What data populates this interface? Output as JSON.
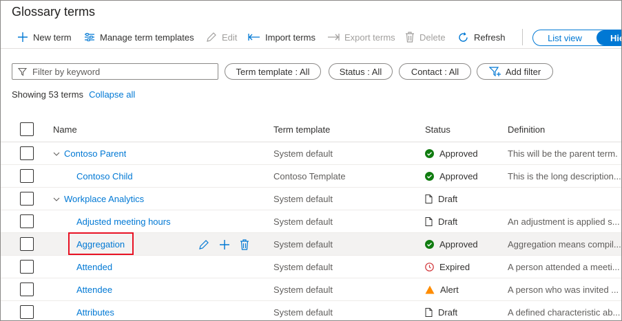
{
  "title": "Glossary terms",
  "toolbar": {
    "new_term": "New term",
    "manage_templates": "Manage term templates",
    "edit": "Edit",
    "import_terms": "Import terms",
    "export_terms": "Export terms",
    "delete": "Delete",
    "refresh": "Refresh"
  },
  "view_toggle": {
    "list": "List view",
    "hierarchy": "Hie"
  },
  "filters": {
    "keyword_placeholder": "Filter by keyword",
    "term_template": "Term template : All",
    "status": "Status : All",
    "contact": "Contact : All",
    "add_filter": "Add filter"
  },
  "summary": {
    "showing": "Showing 53 terms",
    "collapse_all": "Collapse all"
  },
  "columns": {
    "name": "Name",
    "term_template": "Term template",
    "status": "Status",
    "definition": "Definition"
  },
  "accent_color": "#0078d4",
  "status_colors": {
    "approved": "#107c10",
    "expired": "#d13438",
    "alert": "#ff8c00"
  },
  "rows": [
    {
      "name": "Contoso Parent",
      "template": "System default",
      "status": "Approved",
      "status_icon": "check-circle-icon",
      "definition": "This will be the parent term."
    },
    {
      "name": "Contoso Child",
      "template": "Contoso Template",
      "status": "Approved",
      "status_icon": "check-circle-icon",
      "definition": "This is the long description..."
    },
    {
      "name": "Workplace Analytics",
      "template": "System default",
      "status": "Draft",
      "status_icon": "document-icon",
      "definition": ""
    },
    {
      "name": "Adjusted meeting hours",
      "template": "System default",
      "status": "Draft",
      "status_icon": "document-icon",
      "definition": "An adjustment is applied s..."
    },
    {
      "name": "Aggregation",
      "template": "System default",
      "status": "Approved",
      "status_icon": "check-circle-icon",
      "definition": "Aggregation means compil..."
    },
    {
      "name": "Attended",
      "template": "System default",
      "status": "Expired",
      "status_icon": "clock-icon",
      "definition": "A person attended a meeti..."
    },
    {
      "name": "Attendee",
      "template": "System default",
      "status": "Alert",
      "status_icon": "warning-icon",
      "definition": "A person who was invited ..."
    },
    {
      "name": "Attributes",
      "template": "System default",
      "status": "Draft",
      "status_icon": "document-icon",
      "definition": "A defined characteristic ab..."
    }
  ]
}
